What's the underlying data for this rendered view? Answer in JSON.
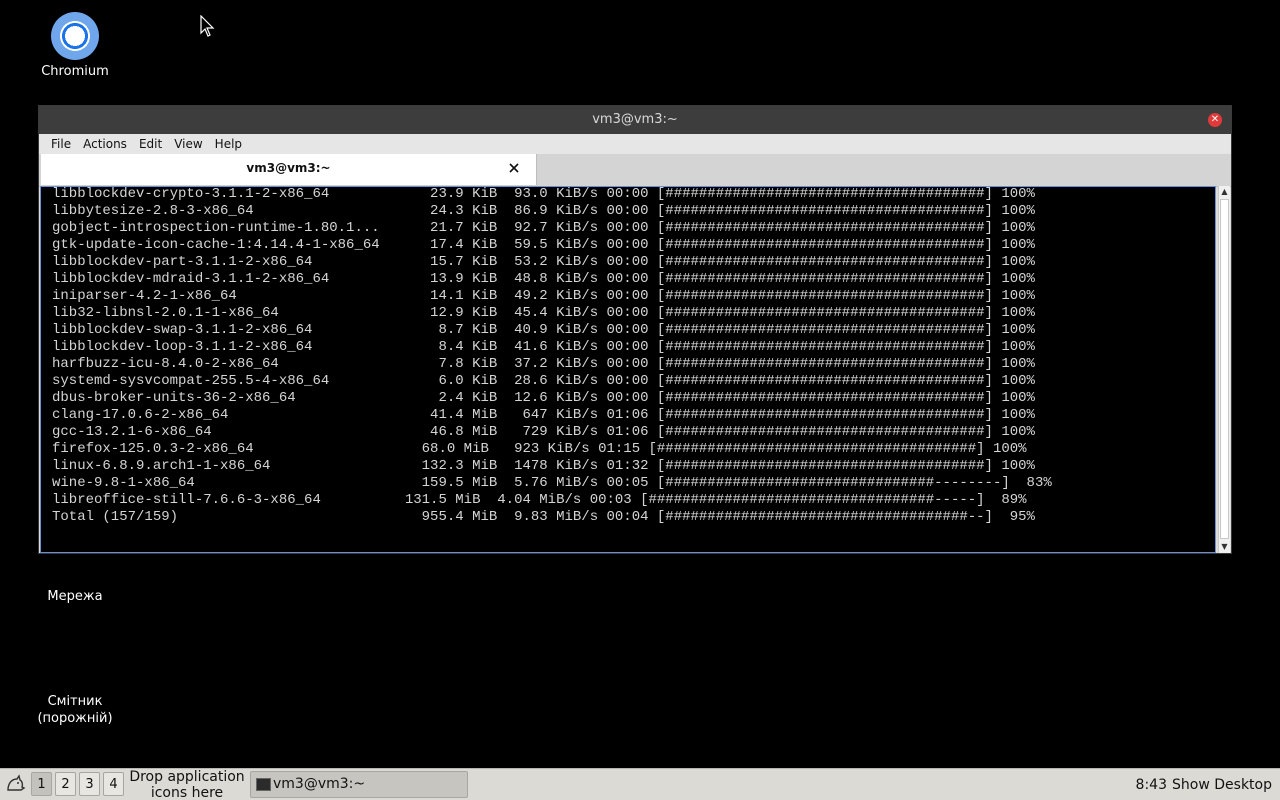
{
  "desktop": {
    "icons": [
      {
        "label": "Chromium"
      },
      {
        "label": "Мережа"
      },
      {
        "label_line1": "Смітник",
        "label_line2": "(порожній)"
      }
    ]
  },
  "terminal": {
    "title": "vm3@vm3:~",
    "menu": [
      "File",
      "Actions",
      "Edit",
      "View",
      "Help"
    ],
    "tab_label": "vm3@vm3:~",
    "lines": [
      "libblockdev-crypto-3.1.1-2-x86_64            23.9 KiB  93.0 KiB/s 00:00 [######################################] 100%",
      "libbytesize-2.8-3-x86_64                     24.3 KiB  86.9 KiB/s 00:00 [######################################] 100%",
      "gobject-introspection-runtime-1.80.1...      21.7 KiB  92.7 KiB/s 00:00 [######################################] 100%",
      "gtk-update-icon-cache-1:4.14.4-1-x86_64      17.4 KiB  59.5 KiB/s 00:00 [######################################] 100%",
      "libblockdev-part-3.1.1-2-x86_64              15.7 KiB  53.2 KiB/s 00:00 [######################################] 100%",
      "libblockdev-mdraid-3.1.1-2-x86_64            13.9 KiB  48.8 KiB/s 00:00 [######################################] 100%",
      "iniparser-4.2-1-x86_64                       14.1 KiB  49.2 KiB/s 00:00 [######################################] 100%",
      "lib32-libnsl-2.0.1-1-x86_64                  12.9 KiB  45.4 KiB/s 00:00 [######################################] 100%",
      "libblockdev-swap-3.1.1-2-x86_64               8.7 KiB  40.9 KiB/s 00:00 [######################################] 100%",
      "libblockdev-loop-3.1.1-2-x86_64               8.4 KiB  41.6 KiB/s 00:00 [######################################] 100%",
      "harfbuzz-icu-8.4.0-2-x86_64                   7.8 KiB  37.2 KiB/s 00:00 [######################################] 100%",
      "systemd-sysvcompat-255.5-4-x86_64             6.0 KiB  28.6 KiB/s 00:00 [######################################] 100%",
      "dbus-broker-units-36-2-x86_64                 2.4 KiB  12.6 KiB/s 00:00 [######################################] 100%",
      "clang-17.0.6-2-x86_64                        41.4 MiB   647 KiB/s 01:06 [######################################] 100%",
      "gcc-13.2.1-6-x86_64                          46.8 MiB   729 KiB/s 01:06 [######################################] 100%",
      "firefox-125.0.3-2-x86_64                    68.0 MiB   923 KiB/s 01:15 [######################################] 100%",
      "linux-6.8.9.arch1-1-x86_64                  132.3 MiB  1478 KiB/s 01:32 [######################################] 100%",
      "wine-9.8-1-x86_64                           159.5 MiB  5.76 MiB/s 00:05 [################################--------]  83%",
      "libreoffice-still-7.6.6-3-x86_64          131.5 MiB  4.04 MiB/s 00:03 [##################################-----]  89%",
      "Total (157/159)                             955.4 MiB  9.83 MiB/s 00:04 [####################################--]  95%"
    ]
  },
  "taskbar": {
    "workspaces": [
      "1",
      "2",
      "3",
      "4"
    ],
    "drop_line1": "Drop application",
    "drop_line2": "icons here",
    "task_label": "vm3@vm3:~",
    "clock": "8:43",
    "show_desktop": "Show Desktop"
  }
}
